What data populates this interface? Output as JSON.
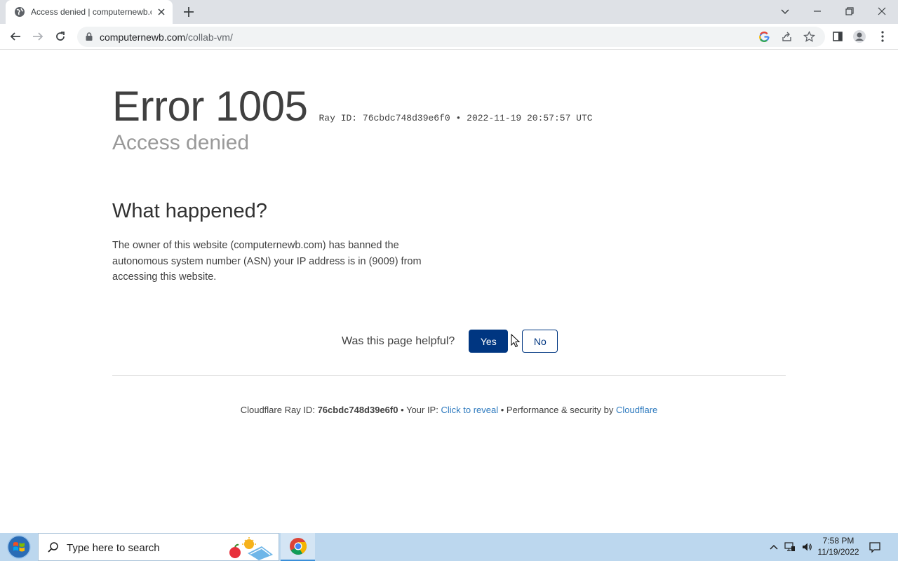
{
  "browser": {
    "tab_title": "Access denied | computernewb.com",
    "url_domain": "computernewb.com",
    "url_path": "/collab-vm/"
  },
  "page": {
    "error_title": "Error 1005",
    "ray_id_label": "Ray ID: 76cbdc748d39e6f0",
    "bullet": "•",
    "timestamp": "2022-11-19 20:57:57 UTC",
    "subtitle": "Access denied",
    "what_heading": "What happened?",
    "what_text": "The owner of this website (computernewb.com) has banned the autonomous system number (ASN) your IP address is in (9009) from accessing this website.",
    "helpful_question": "Was this page helpful?",
    "yes_label": "Yes",
    "no_label": "No"
  },
  "footer": {
    "ray_label": "Cloudflare Ray ID:",
    "ray_id": "76cbdc748d39e6f0",
    "sep1": "•",
    "ip_label": "Your IP:",
    "ip_link": "Click to reveal",
    "sep2": "•",
    "perf_label": "Performance & security by",
    "cf_link": "Cloudflare"
  },
  "taskbar": {
    "search_placeholder": "Type here to search",
    "time": "7:58 PM",
    "date": "11/19/2022"
  },
  "colors": {
    "button_blue": "#003681",
    "link_blue": "#2f7bbf",
    "taskbar": "#bcd7ee"
  }
}
